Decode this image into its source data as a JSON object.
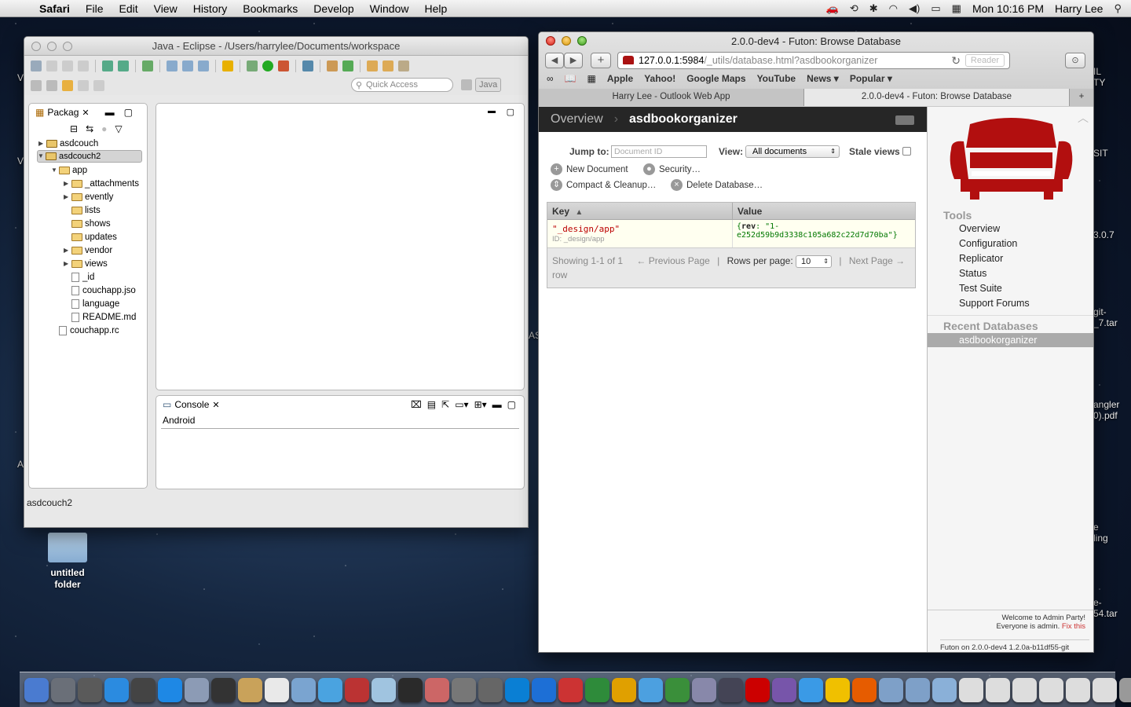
{
  "menubar": {
    "app": "Safari",
    "items": [
      "File",
      "Edit",
      "View",
      "History",
      "Bookmarks",
      "Develop",
      "Window",
      "Help"
    ],
    "clock": "Mon 10:16 PM",
    "user": "Harry Lee"
  },
  "desktop": {
    "folder_label": "untitled\nfolder",
    "edge": [
      "IL\nTY",
      "SIT",
      "3.0.7",
      "git-\n_7.tar",
      "angler\n0).pdf",
      "e\nling",
      "e-\n54.tar"
    ],
    "left_edge": [
      "V",
      "V",
      "A"
    ],
    "mid": "AS"
  },
  "eclipse": {
    "title": "Java - Eclipse - /Users/harrylee/Documents/workspace",
    "quick_access": "Quick Access",
    "perspective": "Java",
    "pkg_tab": "Packag",
    "tree": [
      {
        "label": "asdcouch",
        "kind": "proj",
        "indent": 0,
        "arrow": "▶"
      },
      {
        "label": "asdcouch2",
        "kind": "proj",
        "indent": 0,
        "arrow": "▼",
        "selected": true
      },
      {
        "label": "app",
        "kind": "folder",
        "indent": 1,
        "arrow": "▼"
      },
      {
        "label": "_attachments",
        "kind": "folder",
        "indent": 2,
        "arrow": "▶"
      },
      {
        "label": "evently",
        "kind": "folder",
        "indent": 2,
        "arrow": "▶"
      },
      {
        "label": "lists",
        "kind": "folder",
        "indent": 2,
        "arrow": ""
      },
      {
        "label": "shows",
        "kind": "folder",
        "indent": 2,
        "arrow": ""
      },
      {
        "label": "updates",
        "kind": "folder",
        "indent": 2,
        "arrow": ""
      },
      {
        "label": "vendor",
        "kind": "folder",
        "indent": 2,
        "arrow": "▶"
      },
      {
        "label": "views",
        "kind": "folder",
        "indent": 2,
        "arrow": "▶"
      },
      {
        "label": "_id",
        "kind": "file",
        "indent": 2,
        "arrow": ""
      },
      {
        "label": "couchapp.jso",
        "kind": "file",
        "indent": 2,
        "arrow": ""
      },
      {
        "label": "language",
        "kind": "file",
        "indent": 2,
        "arrow": ""
      },
      {
        "label": "README.md",
        "kind": "file",
        "indent": 2,
        "arrow": ""
      },
      {
        "label": "couchapp.rc",
        "kind": "file",
        "indent": 1,
        "arrow": ""
      }
    ],
    "console_tab": "Console",
    "console_text": "Android",
    "status": "asdcouch2"
  },
  "safari": {
    "title": "2.0.0-dev4 - Futon: Browse Database",
    "url_host": "127.0.0.1:5984",
    "url_path": "/_utils/database.html?asdbookorganizer",
    "reader": "Reader",
    "bookmarks": [
      "Apple",
      "Yahoo!",
      "Google Maps",
      "YouTube",
      "News ▾",
      "Popular ▾"
    ],
    "tabs": [
      "Harry Lee - Outlook Web App",
      "2.0.0-dev4 - Futon: Browse Database"
    ]
  },
  "futon": {
    "crumb_overview": "Overview",
    "crumb_db": "asdbookorganizer",
    "jump_label": "Jump to:",
    "jump_placeholder": "Document ID",
    "view_label": "View:",
    "view_value": "All documents",
    "stale_label": "Stale views",
    "actions": {
      "new_doc": "New Document",
      "security": "Security…",
      "compact": "Compact & Cleanup…",
      "delete": "Delete Database…"
    },
    "grid": {
      "key_header": "Key",
      "value_header": "Value",
      "row_key": "\"_design/app\"",
      "row_id": "ID: _design/app",
      "row_value_key": "rev",
      "row_value": "\"1-e252d59b9d3338c105a682c22d7d70ba\"",
      "showing": "Showing 1-1 of 1",
      "prev": "← Previous Page",
      "rows_label": "Rows per page:",
      "rows_value": "10",
      "next": "Next Page →",
      "row_word": "row"
    },
    "tools_header": "Tools",
    "tools": [
      "Overview",
      "Configuration",
      "Replicator",
      "Status",
      "Test Suite",
      "Support Forums"
    ],
    "recent_header": "Recent Databases",
    "recent": [
      "asdbookorganizer"
    ],
    "admin1": "Welcome to Admin Party!",
    "admin2": "Everyone is admin.",
    "fix": "Fix this",
    "version": "Futon on 2.0.0-dev4 1.2.0a-b11df55-git"
  },
  "dock_colors": [
    "#4a7bd0",
    "#6a6f78",
    "#5a5a5a",
    "#2b8be0",
    "#444",
    "#1e88e5",
    "#8c9bb5",
    "#333",
    "#c9a25a",
    "#e9e9e9",
    "#7aa4d0",
    "#4aa3e0",
    "#b33",
    "#a0c4e0",
    "#2a2a2a",
    "#c66",
    "#777",
    "#666",
    "#0a7fd4",
    "#1d6fd6",
    "#c33",
    "#2e8b3a",
    "#e0a000",
    "#4ca0e0",
    "#3a8f3a",
    "#88a",
    "#445",
    "#c00",
    "#7755aa",
    "#3a9ae6",
    "#f0c000",
    "#e65c00",
    "#7ea0c8",
    "#7ea0c8",
    "#8ab0d8",
    "#ddd",
    "#ddd",
    "#ddd",
    "#ddd",
    "#ddd",
    "#ddd",
    "#999"
  ]
}
